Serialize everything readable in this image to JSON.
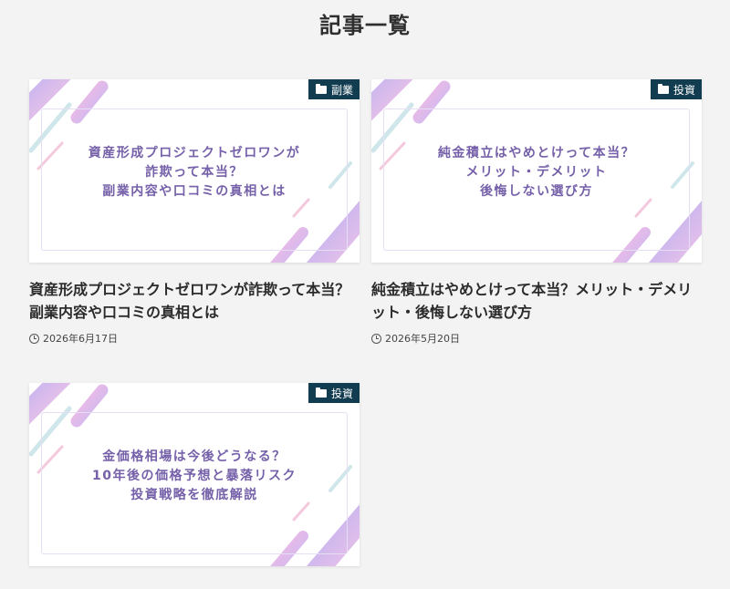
{
  "page": {
    "title": "記事一覧"
  },
  "articles": [
    {
      "category": "副業",
      "thumb_lines": [
        "資産形成プロジェクトゼロワンが",
        "詐欺って本当？",
        "副業内容や口コミの真相とは"
      ],
      "title": "資産形成プロジェクトゼロワンが詐欺って本当？副業内容や口コミの真相とは",
      "date": "2026年6月17日"
    },
    {
      "category": "投資",
      "thumb_lines": [
        "純金積立はやめとけって本当？",
        "メリット・デメリット",
        "後悔しない選び方"
      ],
      "title": "純金積立はやめとけって本当？メリット・デメリット・後悔しない選び方",
      "date": "2026年5月20日"
    },
    {
      "category": "投資",
      "thumb_lines": [
        "金価格相場は今後どうなる？",
        "10年後の価格予想と暴落リスク",
        "投資戦略を徹底解説"
      ],
      "title": "",
      "date": ""
    }
  ],
  "icons": {
    "category": "folder-icon",
    "date": "clock-icon"
  },
  "colors": {
    "badge_bg": "#123d51",
    "thumb_text": "#7560a9",
    "page_bg": "#f3f3f4"
  }
}
